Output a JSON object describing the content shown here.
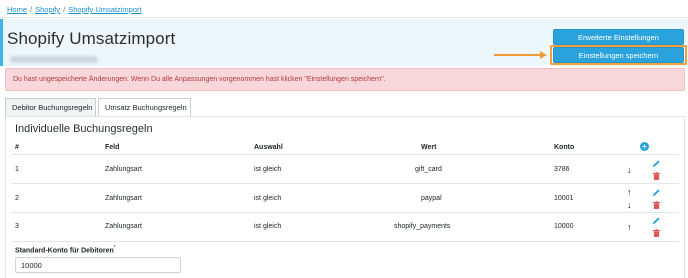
{
  "breadcrumb": {
    "items": [
      "Home",
      "Shopify",
      "Shopify Umsatzimport"
    ],
    "separator": "/"
  },
  "header": {
    "title": "Shopify Umsatzimport",
    "buttons": {
      "advanced_settings": "Erweiterte Einstellungen",
      "save_settings": "Einstellungen speichern"
    }
  },
  "alert": {
    "text": "Du hast ungespeicherte Änderungen. Wenn Du alle Anpassungen vorgenommen hast klicken \"Einstellungen speichern\"."
  },
  "tabs": [
    {
      "label": "Debitor Buchungsregeln",
      "active": false
    },
    {
      "label": "Umsatz Buchungsregeln",
      "active": true
    }
  ],
  "rules": {
    "title": "Individuelle Buchungsregeln",
    "columns": [
      "#",
      "Feld",
      "Auswahl",
      "Wert",
      "Konto"
    ],
    "rows": [
      {
        "num": "1",
        "feld": "Zahlungsart",
        "auswahl": "ist gleich",
        "wert": "gift_card",
        "konto": "3786",
        "move_up": false,
        "move_down": true
      },
      {
        "num": "2",
        "feld": "Zahlungsart",
        "auswahl": "ist gleich",
        "wert": "paypal",
        "konto": "10001",
        "move_up": true,
        "move_down": true
      },
      {
        "num": "3",
        "feld": "Zahlungsart",
        "auswahl": "ist gleich",
        "wert": "shopify_payments",
        "konto": "10000",
        "move_up": true,
        "move_down": false
      }
    ]
  },
  "standard_konto": {
    "label": "Standard-Konto für Debitoren",
    "required_marker": "*",
    "value": "10000"
  },
  "icons": {
    "add": "plus-circle-icon",
    "edit": "pencil-icon",
    "delete": "trash-icon",
    "up": "arrow-up-icon",
    "down": "arrow-down-icon"
  },
  "colors": {
    "accent": "#2aa3dc",
    "highlight": "#f29c38",
    "alert_bg": "#f8d7da",
    "alert_text": "#b23a3f",
    "danger": "#e05555"
  }
}
